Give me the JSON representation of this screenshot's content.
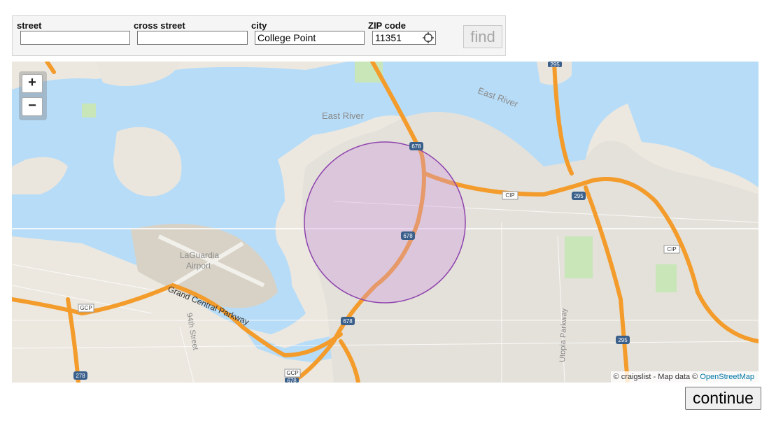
{
  "form": {
    "street": {
      "label": "street",
      "value": ""
    },
    "cross_street": {
      "label": "cross street",
      "value": ""
    },
    "city": {
      "label": "city",
      "value": "College Point"
    },
    "zip": {
      "label": "ZIP code",
      "value": "11351"
    },
    "find_label": "find"
  },
  "map": {
    "water_labels": [
      "East River",
      "East River"
    ],
    "place_labels": [
      "LaGuardia",
      "Airport",
      "Grand Central Parkway",
      "94th Street",
      "Utopia Parkway"
    ],
    "shields": [
      "678",
      "678",
      "678",
      "678",
      "295",
      "295",
      "295",
      "278",
      "GCP",
      "CIP",
      "CIP",
      "GCP"
    ],
    "attribution_text": "© craigslist - Map data © ",
    "attribution_link": "OpenStreetMap",
    "zoom_in": "+",
    "zoom_out": "−",
    "colors": {
      "water": "#b7dcf7",
      "land": "#ece8e0",
      "highway": "#f39c2c",
      "radius": "#8e44ad"
    }
  },
  "continue_label": "continue"
}
